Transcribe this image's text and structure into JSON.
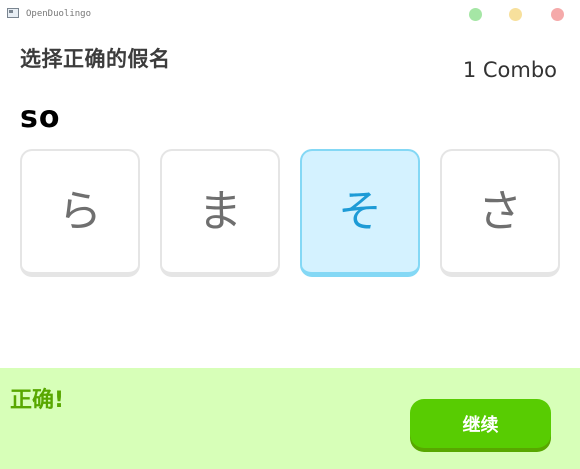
{
  "window": {
    "title": "OpenDuolingo",
    "icon": "app-window-icon",
    "controls": {
      "minimize_color": "#a5e6a5",
      "maximize_color": "#f7e09c",
      "close_color": "#f5aaaa"
    }
  },
  "question": {
    "title": "选择正确的假名",
    "romaji": "so",
    "combo": "1 Combo"
  },
  "choices": [
    {
      "kana": "ら",
      "selected": false
    },
    {
      "kana": "ま",
      "selected": false
    },
    {
      "kana": "そ",
      "selected": true
    },
    {
      "kana": "さ",
      "selected": false
    }
  ],
  "feedback": {
    "message": "正确!",
    "continue_label": "继续",
    "background_color": "#d7ffb8",
    "accent_color": "#58cc02"
  }
}
